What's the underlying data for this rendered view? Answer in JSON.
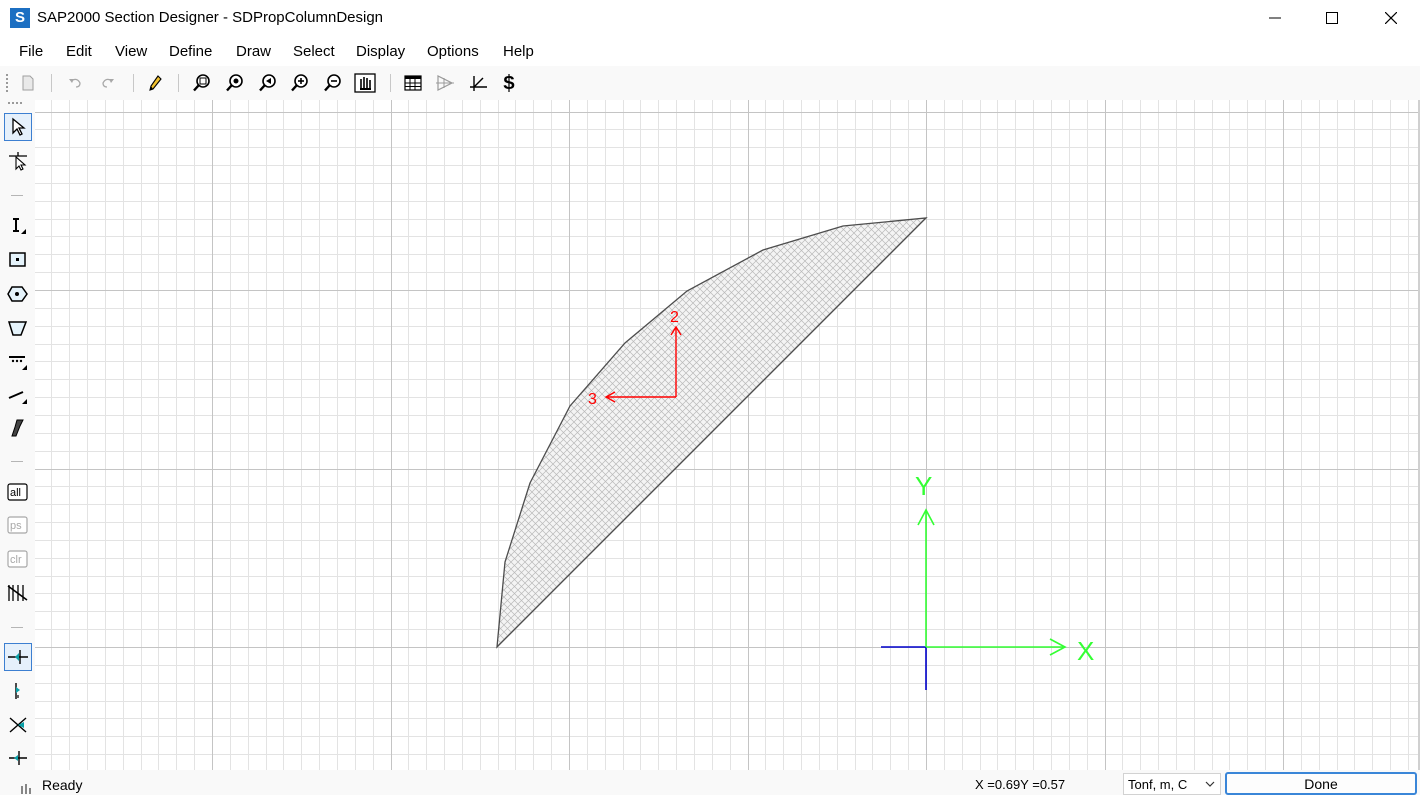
{
  "app": {
    "icon_letter": "S",
    "title": "SAP2000 Section Designer - SDPropColumnDesign"
  },
  "window_controls": [
    "minimize-icon",
    "maximize-icon",
    "close-icon"
  ],
  "menu": {
    "items": [
      "File",
      "Edit",
      "View",
      "Define",
      "Draw",
      "Select",
      "Display",
      "Options",
      "Help"
    ]
  },
  "toolbar": {
    "buttons": [
      "new-file-icon",
      "undo-icon",
      "redo-icon",
      "pencil-icon",
      "zoom-window-icon",
      "restore-full-view-icon",
      "restore-previous-view-icon",
      "zoom-in-icon",
      "zoom-out-icon",
      "pan-icon",
      "table-icon",
      "section-property-icon",
      "axes-icon",
      "snap-s-icon"
    ]
  },
  "left_toolbar": {
    "buttons": [
      "pointer-icon",
      "reshape-icon",
      "draw-i-section-icon",
      "draw-rectangle-icon",
      "draw-circle-icon",
      "draw-polygon-icon",
      "draw-rebar-line-icon",
      "draw-line-icon",
      "draw-reference-icon",
      "select-all-icon",
      "previous-selection-icon",
      "clear-selection-icon",
      "section-cut-icon",
      "snap-point-icon",
      "snap-end-icon",
      "snap-intersection-icon",
      "snap-perpendicular-icon"
    ],
    "active": [
      "pointer-icon",
      "snap-point-icon"
    ],
    "disabled": [
      "previous-selection-icon",
      "clear-selection-icon"
    ]
  },
  "canvas": {
    "grid_color": "#e3e3e3",
    "major_grid_color": "#c4c4c4",
    "shape_fill": "#f4f4f4",
    "shape_hatch": "#b9b9b9",
    "shape_edge": "#4d4d4d",
    "local_axes": {
      "color": "#ff0000",
      "labels": [
        "2",
        "3"
      ]
    },
    "global_axes": {
      "color": "#33ff33",
      "origin_color": "#0000cc",
      "labels": [
        "X",
        "Y"
      ]
    }
  },
  "status": {
    "text": "Ready",
    "coords": "X =0.69Y =0.57",
    "units": "Tonf, m, C",
    "done_label": "Done"
  }
}
